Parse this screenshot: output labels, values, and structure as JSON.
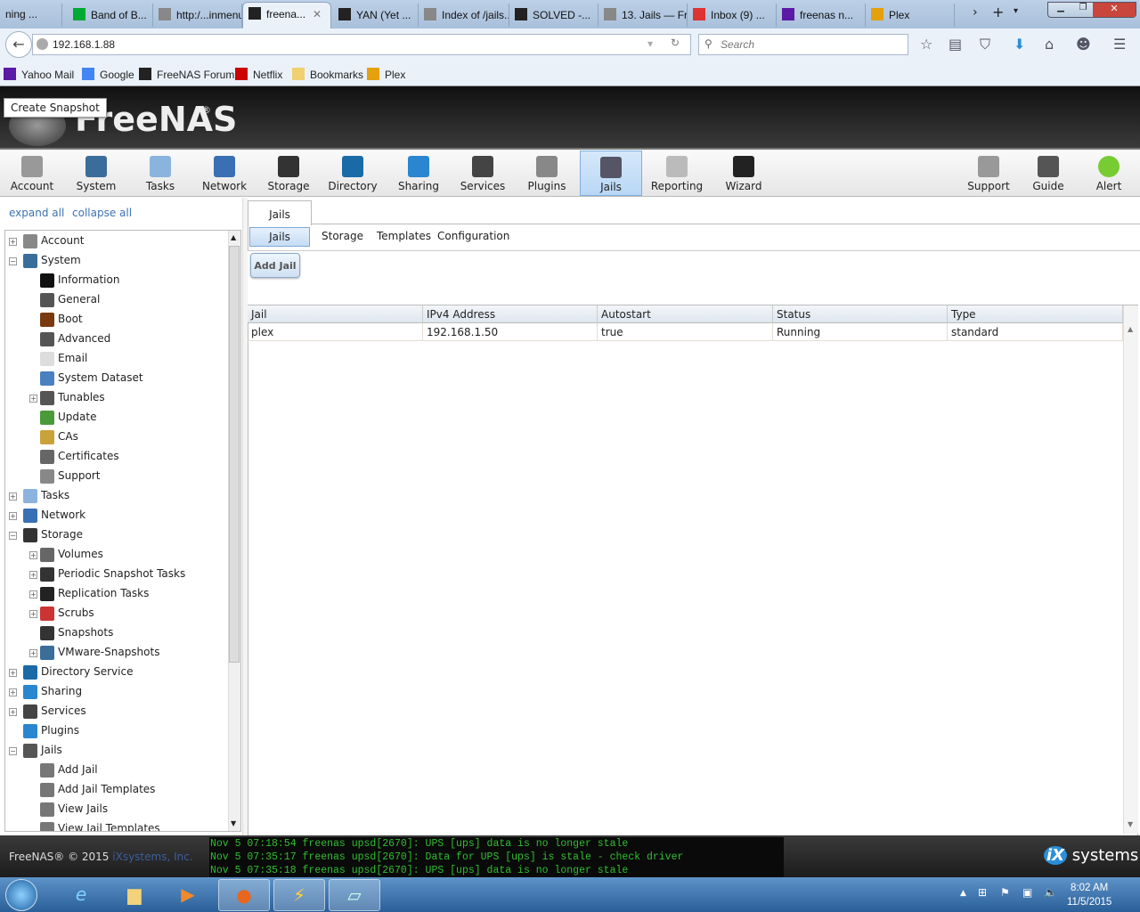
{
  "browser": {
    "tabs": [
      {
        "label": "ning ..."
      },
      {
        "label": "Band of B..."
      },
      {
        "label": "http:/...inmenu"
      },
      {
        "label": "freena...",
        "active": true
      },
      {
        "label": "YAN (Yet ..."
      },
      {
        "label": "Index of /jails..."
      },
      {
        "label": "SOLVED -..."
      },
      {
        "label": "13. Jails — Fre..."
      },
      {
        "label": "Inbox (9) ..."
      },
      {
        "label": "freenas n..."
      },
      {
        "label": "Plex"
      }
    ],
    "url": "192.168.1.88",
    "search_placeholder": "Search",
    "bookmarks": [
      {
        "label": "Yahoo Mail"
      },
      {
        "label": "Google"
      },
      {
        "label": "FreeNAS Forum"
      },
      {
        "label": "Netflix"
      },
      {
        "label": "Bookmarks"
      },
      {
        "label": "Plex"
      }
    ]
  },
  "app": {
    "logo": "FreeNAS",
    "tooltip": "Create Snapshot",
    "toolbar": [
      {
        "label": "Account"
      },
      {
        "label": "System"
      },
      {
        "label": "Tasks"
      },
      {
        "label": "Network"
      },
      {
        "label": "Storage"
      },
      {
        "label": "Directory"
      },
      {
        "label": "Sharing"
      },
      {
        "label": "Services"
      },
      {
        "label": "Plugins"
      },
      {
        "label": "Jails",
        "active": true
      },
      {
        "label": "Reporting"
      },
      {
        "label": "Wizard"
      },
      {
        "label": "Support"
      },
      {
        "label": "Guide"
      },
      {
        "label": "Alert"
      }
    ],
    "expand_all": "expand all",
    "collapse_all": "collapse all",
    "tree": [
      {
        "label": "Account",
        "level": 0,
        "expander": "+"
      },
      {
        "label": "System",
        "level": 0,
        "expander": "-"
      },
      {
        "label": "Information",
        "level": 1
      },
      {
        "label": "General",
        "level": 1
      },
      {
        "label": "Boot",
        "level": 1
      },
      {
        "label": "Advanced",
        "level": 1
      },
      {
        "label": "Email",
        "level": 1
      },
      {
        "label": "System Dataset",
        "level": 1
      },
      {
        "label": "Tunables",
        "level": 1,
        "expander": "+"
      },
      {
        "label": "Update",
        "level": 1
      },
      {
        "label": "CAs",
        "level": 1
      },
      {
        "label": "Certificates",
        "level": 1
      },
      {
        "label": "Support",
        "level": 1
      },
      {
        "label": "Tasks",
        "level": 0,
        "expander": "+"
      },
      {
        "label": "Network",
        "level": 0,
        "expander": "+"
      },
      {
        "label": "Storage",
        "level": 0,
        "expander": "-"
      },
      {
        "label": "Volumes",
        "level": 1,
        "expander": "+"
      },
      {
        "label": "Periodic Snapshot Tasks",
        "level": 1,
        "expander": "+"
      },
      {
        "label": "Replication Tasks",
        "level": 1,
        "expander": "+"
      },
      {
        "label": "Scrubs",
        "level": 1,
        "expander": "+"
      },
      {
        "label": "Snapshots",
        "level": 1
      },
      {
        "label": "VMware-Snapshots",
        "level": 1,
        "expander": "+"
      },
      {
        "label": "Directory Service",
        "level": 0,
        "expander": "+"
      },
      {
        "label": "Sharing",
        "level": 0,
        "expander": "+"
      },
      {
        "label": "Services",
        "level": 0,
        "expander": "+"
      },
      {
        "label": "Plugins",
        "level": 0
      },
      {
        "label": "Jails",
        "level": 0,
        "expander": "-"
      },
      {
        "label": "Add Jail",
        "level": 1
      },
      {
        "label": "Add Jail Templates",
        "level": 1
      },
      {
        "label": "View Jails",
        "level": 1
      },
      {
        "label": "View Jail Templates",
        "level": 1
      }
    ],
    "main_tab": "Jails",
    "subtabs": [
      {
        "label": "Jails",
        "active": true
      },
      {
        "label": "Storage"
      },
      {
        "label": "Templates"
      },
      {
        "label": "Configuration"
      }
    ],
    "add_jail": "Add Jail",
    "grid": {
      "columns": [
        "Jail",
        "IPv4 Address",
        "Autostart",
        "Status",
        "Type"
      ],
      "rows": [
        [
          "plex",
          "192.168.1.50",
          "true",
          "Running",
          "standard"
        ]
      ]
    },
    "footer": {
      "copyright": "FreeNAS® © 2015",
      "company": "iXsystems, Inc.",
      "brand": "systems",
      "brand_mark": "iX"
    },
    "log": [
      "Nov  5 07:18:54 freenas upsd[2670]: UPS [ups] data is no longer stale",
      "Nov  5 07:35:17 freenas upsd[2670]: Data for UPS [ups] is stale - check driver",
      "Nov  5 07:35:18 freenas upsd[2670]: UPS [ups] data is no longer stale"
    ]
  },
  "taskbar": {
    "time": "8:02 AM",
    "date": "11/5/2015"
  },
  "colors": {
    "accent": "#7eaedf",
    "log_text": "#2fbf2f",
    "link": "#3d73b0"
  }
}
